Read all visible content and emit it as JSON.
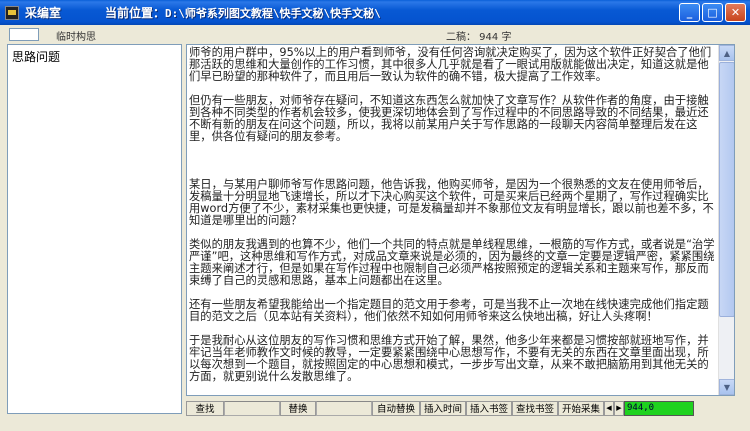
{
  "window": {
    "app_title": "采编室",
    "location_label": "当前位置：",
    "location_path": "D:\\师爷系列图文教程\\快手文秘\\快手文秘\\"
  },
  "info": {
    "temp_label": "临时构思",
    "count_label": "二稿： 944 字"
  },
  "left_panel": {
    "items": [
      {
        "label": "思路问题"
      }
    ]
  },
  "editor": {
    "paragraphs": [
      "师爷的用户群中，95%以上的用户看到师爷，没有任何咨询就决定购买了，因为这个软件正好契合了他们那活跃的思维和大量创作的工作习惯，其中很多人几乎就是看了一眼试用版就能做出决定，知道这就是他们早已盼望的那种软件了，而且用后一致认为软件的确不错，极大提高了工作效率。",
      "但仍有一些朋友，对师爷存在疑问，不知道这东西怎么就加快了文章写作？从软件作者的角度，由于接触到各种不同类型的作者机会较多，使我更深切地体会到了写作过程中的不同思路导致的不同结果，最近还不断有新的朋友在问这个问题，所以，我将以前某用户关于写作思路的一段聊天内容简单整理后发在这里，供各位有疑问的朋友参考。",
      "某日，与某用户聊师爷写作思路问题，他告诉我，他购买师爷，是因为一个很熟悉的文友在使用师爷后，发稿量十分明显地飞速增长，所以才下决心购买这个软件，可是买来后已经两个星期了，写作过程确实比用word方便了不少，素材采集也更快捷，可是发稿量却并不象那位文友有明显增长，跟以前也差不多，不知道是哪里出的问题？",
      "类似的朋友我遇到的也算不少，他们一个共同的特点就是单线程思维，一根筋的写作方式，或者说是“治学严谨”吧，这种思维和写作方式，对成品文章来说是必须的，因为最终的文章一定要是逻辑严密，紧紧围绕主题来阐述才行，但是如果在写作过程中也限制自己必须严格按照预定的逻辑关系和主题来写作，那反而束缚了自己的灵感和思路，基本上问题都出在这里。",
      "还有一些朋友希望我能给出一个指定题目的范文用于参考，可是当我不止一次地在线快速完成他们指定题目的范文之后（见本站有关资料），他们依然不知如何用师爷来这么快地出稿，好让人头疼啊！",
      "于是我耐心从这位朋友的写作习惯和思维方式开始了解，果然，他多少年来都是习惯按部就班地写作，并牢记当年老师教作文时候的教导，一定要紧紧围绕中心思想写作，不要有无关的东西在文章里面出现，所以每次想到一个题目，就按照固定的中心思想和模式，一步步写出文章，从来不敢把脑筋用到其他无关的方面，就更别说什么发散思维了。"
    ]
  },
  "toolbar": {
    "find": "查找",
    "replace": "替换",
    "auto_replace": "自动替换",
    "insert_time": "插入时间",
    "insert_bookmark": "插入书签",
    "find_bookmark": "查找书签",
    "start_collect": "开始采集",
    "status": "944,0"
  },
  "colors": {
    "titlebar": "#0553cf",
    "status_green": "#1fd21f",
    "background": "#ece9d8"
  }
}
